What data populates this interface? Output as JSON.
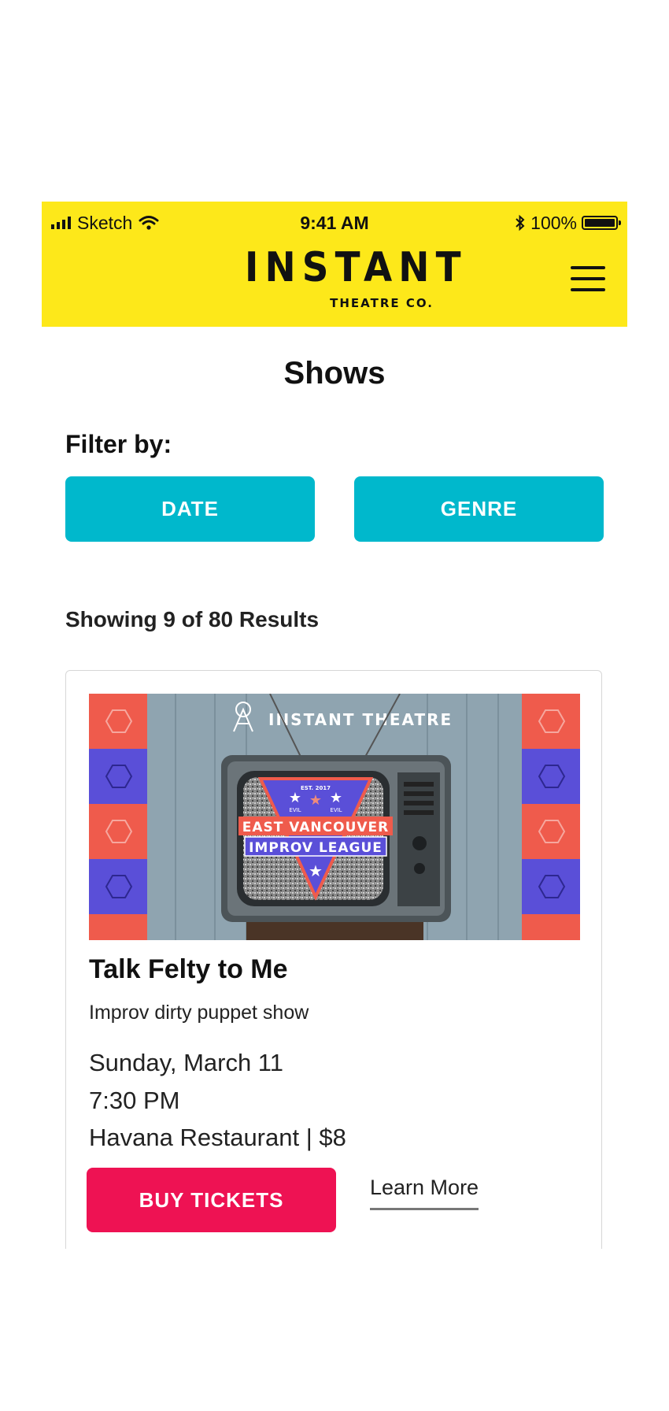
{
  "status_bar": {
    "carrier": "Sketch",
    "time": "9:41 AM",
    "battery": "100%",
    "bluetooth_icon": "bluetooth-icon",
    "wifi_icon": "wifi-icon"
  },
  "header": {
    "logo_text": "INSTANT",
    "logo_subtext": "THEATRE CO.",
    "menu_icon": "hamburger-menu-icon",
    "background_color": "#fde81a"
  },
  "page": {
    "title": "Shows"
  },
  "filters": {
    "label": "Filter by:",
    "date_label": "DATE",
    "genre_label": "GENRE",
    "button_color": "#00b8cc"
  },
  "results": {
    "summary": "Showing 9 of 80 Results"
  },
  "show": {
    "image": {
      "brand": "INSTANT THEATRE",
      "badge_line1": "EAST VANCOUVER",
      "badge_line2": "IMPROV LEAGUE",
      "badge_est": "EST. 2017",
      "badge_left": "EVIL",
      "badge_right": "EVIL"
    },
    "title": "Talk Felty to Me",
    "subtitle": "Improv dirty puppet show",
    "date": "Sunday, March 11",
    "time": "7:30 PM",
    "venue_price": "Havana Restaurant | $8",
    "buy_label": "BUY TICKETS",
    "learn_more_label": "Learn More",
    "buy_color": "#ee1253"
  }
}
